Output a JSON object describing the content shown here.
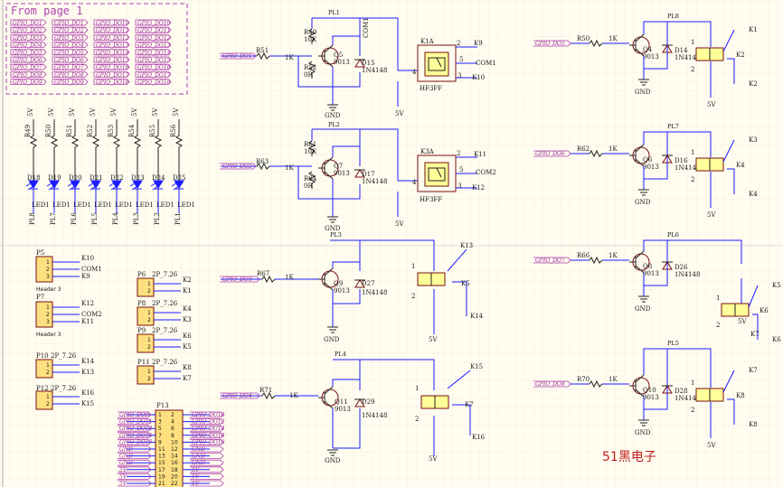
{
  "page": {
    "from_page_title": "From page 1",
    "watermark": "51黑电子",
    "colors": {
      "wire": "#1c1cff",
      "component": "#7a1010",
      "relay_fill": "#ffff99",
      "header_fill": "#ffe080",
      "port": "#b040b0",
      "watermark": "#c02020",
      "grid": "#e6e0cf"
    }
  },
  "from_page": {
    "col1": [
      "GPIO_DO1",
      "GPIO_DO2",
      "GPIO_DO3",
      "GPIO_DO4",
      "GPIO_DO5",
      "GPIO_DO6",
      "GPIO_DO7",
      "GPIO_DO8",
      "GPIO_DO9"
    ],
    "col2": [
      "GPIO_DO1",
      "GPIO_DO2",
      "GPIO_DO3",
      "GPIO_DO4",
      "GPIO_DO5",
      "GPIO_DO6",
      "GPIO_DO7",
      "GPIO_DO8",
      "GPIO_DO9"
    ],
    "col3": [
      "GPIO_DO10",
      "GPIO_DO11",
      "GPIO_DO12",
      "GPIO_DO13",
      "GPIO_DO14",
      "GPIO_DO15",
      "GPIO_DO16",
      "GPIO_DO17",
      "GPIO_DO18"
    ],
    "col4": [
      "GPIO_DO10",
      "GPIO_DO11",
      "GPIO_DO12",
      "GPIO_DO13",
      "GPIO_DO14",
      "GPIO_DO15",
      "GPIO_DO16",
      "GPIO_DO17",
      "GPIO_DO18"
    ]
  },
  "leds": [
    {
      "vcc": "5V",
      "r": "R49",
      "d": "D18",
      "led": "LED1",
      "net": "PL8"
    },
    {
      "vcc": "5V",
      "r": "R50",
      "d": "D19",
      "led": "LED1",
      "net": "PL7"
    },
    {
      "vcc": "5V",
      "r": "R51",
      "d": "D20",
      "led": "LED1",
      "net": "PL6"
    },
    {
      "vcc": "5V",
      "r": "R52",
      "d": "D21",
      "led": "LED1",
      "net": "PL5"
    },
    {
      "vcc": "5V",
      "r": "R53",
      "d": "D22",
      "led": "LED1",
      "net": "PL4"
    },
    {
      "vcc": "5V",
      "r": "R54",
      "d": "D23",
      "led": "LED1",
      "net": "PL3"
    },
    {
      "vcc": "5V",
      "r": "R55",
      "d": "D24",
      "led": "LED1",
      "net": "PL2"
    },
    {
      "vcc": "5V",
      "r": "R56",
      "d": "D25",
      "led": "LED1",
      "net": "PL1"
    }
  ],
  "headers": {
    "p5": {
      "ref": "P5",
      "type": "Header 3",
      "nets": [
        "K10",
        "COM1",
        "K9"
      ],
      "pins": [
        "1",
        "2",
        "3"
      ]
    },
    "p7": {
      "ref": "P7",
      "type": "Header 3",
      "nets": [
        "K12",
        "COM2",
        "K11"
      ],
      "pins": [
        "1",
        "2",
        "3"
      ]
    },
    "p10": {
      "ref": "P10",
      "type": "2P_7.26",
      "nets": [
        "K14",
        "K13"
      ],
      "pins": [
        "1",
        "2"
      ]
    },
    "p12": {
      "ref": "P12",
      "type": "2P_7.26",
      "nets": [
        "K16",
        "K15"
      ],
      "pins": [
        "1",
        "2"
      ]
    },
    "p6": {
      "ref": "P6",
      "type": "2P_7.26",
      "nets": [
        "K2",
        "K1"
      ],
      "pins": [
        "1",
        "2"
      ]
    },
    "p8": {
      "ref": "P8",
      "type": "2P_7.26",
      "nets": [
        "K4",
        "K3"
      ],
      "pins": [
        "1",
        "2"
      ]
    },
    "p9": {
      "ref": "P9",
      "type": "2P_7.26",
      "nets": [
        "K6",
        "K5"
      ],
      "pins": [
        "1",
        "2"
      ]
    },
    "p11": {
      "ref": "P11",
      "type": "2P_7.26",
      "nets": [
        "K8",
        "K7"
      ],
      "pins": [
        "1",
        "2"
      ]
    }
  },
  "p13": {
    "ref": "P13",
    "left": [
      "GPIO_DO9",
      "GPIO_DO11",
      "GPIO_DO13",
      "GPIO_DO15",
      "GPIO_DO17",
      "GND",
      "GND",
      "GND",
      "5V",
      "5V",
      "5V"
    ],
    "right": [
      "GPIO_DO10",
      "GPIO_DO12",
      "GPIO_DO14",
      "GPIO_DO16",
      "GPIO_DO18",
      "GND",
      "GND",
      "GND",
      "5V",
      "5V",
      "5V"
    ],
    "pins_left": [
      "1",
      "3",
      "5",
      "7",
      "9",
      "11",
      "13",
      "15",
      "17",
      "19",
      "21"
    ],
    "pins_right": [
      "2",
      "4",
      "6",
      "8",
      "10",
      "12",
      "14",
      "16",
      "18",
      "20",
      "22"
    ]
  },
  "ch1": {
    "net": "PL1",
    "input": "GPIO_DO1",
    "rb": "R51",
    "rb_val": "1K",
    "rpu": "R49",
    "rpu_val": "10K",
    "rbe": "R52",
    "rbe_val": "0R",
    "q": "Q5",
    "q_type": "9013",
    "d": "D15",
    "d_type": "1N4148",
    "relay": "K1A",
    "relay_type": "HF3FF",
    "no": "K9",
    "com": "COM1",
    "nc": "K10",
    "p1": "1",
    "p2": "2",
    "p3": "3",
    "p4": "4",
    "p5": "5",
    "com_lbl": "COM1",
    "gnd": "GND",
    "vcc": "5V"
  },
  "ch2": {
    "net": "PL2",
    "input": "GPIO_DO2",
    "rb": "R63",
    "rb_val": "1K",
    "rpu": "R61",
    "rpu_val": "10K",
    "rbe": "R64",
    "rbe_val": "0R",
    "q": "Q7",
    "q_type": "9013",
    "d": "D17",
    "d_type": "1N4148",
    "relay": "K3A",
    "relay_type": "HF3FF",
    "no": "K11",
    "com": "COM2",
    "nc": "K12",
    "p1": "1",
    "p2": "2",
    "p3": "3",
    "p4": "4",
    "p5": "5",
    "gnd": "GND",
    "vcc": "5V"
  },
  "ch3": {
    "net": "PL3",
    "input": "GPIO_DO3",
    "rb": "R67",
    "rb_val": "1K",
    "q": "Q9",
    "q_type": "9013",
    "d": "D27",
    "d_type": "1N4148",
    "relay": "K5",
    "no": "K13",
    "com": "K14",
    "p1": "1",
    "p2": "2",
    "gnd": "GND",
    "vcc": "5V"
  },
  "ch4": {
    "net": "PL4",
    "input": "GPIO_DO4",
    "rb": "R71",
    "rb_val": "1K",
    "q": "Q11",
    "q_type": "9013",
    "d": "D29",
    "d_type": "1N4148",
    "relay": "K7",
    "no": "K15",
    "com": "K16",
    "p1": "1",
    "p2": "2",
    "gnd": "GND",
    "vcc": "5V"
  },
  "ch5": {
    "net": "PL8",
    "input": "GPIO_DO5",
    "rb": "R50",
    "rb_val": "1K",
    "q": "Q4",
    "q_type": "9013",
    "d": "D14",
    "d_type": "1N4148",
    "relay": "K2",
    "no": "K1",
    "com": "K2",
    "p1": "1",
    "p2": "2",
    "gnd": "GND",
    "vcc": "5V"
  },
  "ch6": {
    "net": "PL7",
    "input": "GPIO_DO6",
    "rb": "R62",
    "rb_val": "1K",
    "q": "Q6",
    "q_type": "9013",
    "d": "D16",
    "d_type": "1N4148",
    "relay": "K4",
    "no": "K3",
    "com": "K4",
    "p1": "1",
    "p2": "2",
    "gnd": "GND",
    "vcc": "5V"
  },
  "ch7": {
    "net": "PL6",
    "input": "GPIO_DO7",
    "rb": "R66",
    "rb_val": "1K",
    "q": "Q8",
    "q_type": "9013",
    "d": "D26",
    "d_type": "1N4148",
    "relay": "K6",
    "no": "K5",
    "com": "K6",
    "com2": "K7",
    "p1": "1",
    "p2": "2",
    "gnd": "GND",
    "vcc": "5V"
  },
  "ch8": {
    "net": "PL5",
    "input": "GPIO_DO8",
    "rb": "R70",
    "rb_val": "1K",
    "q": "Q10",
    "q_type": "9013",
    "d": "D28",
    "d_type": "1N4148",
    "relay": "K8",
    "no": "K7",
    "com": "K8",
    "p1": "1",
    "p2": "2",
    "gnd": "GND",
    "vcc": "5V"
  }
}
